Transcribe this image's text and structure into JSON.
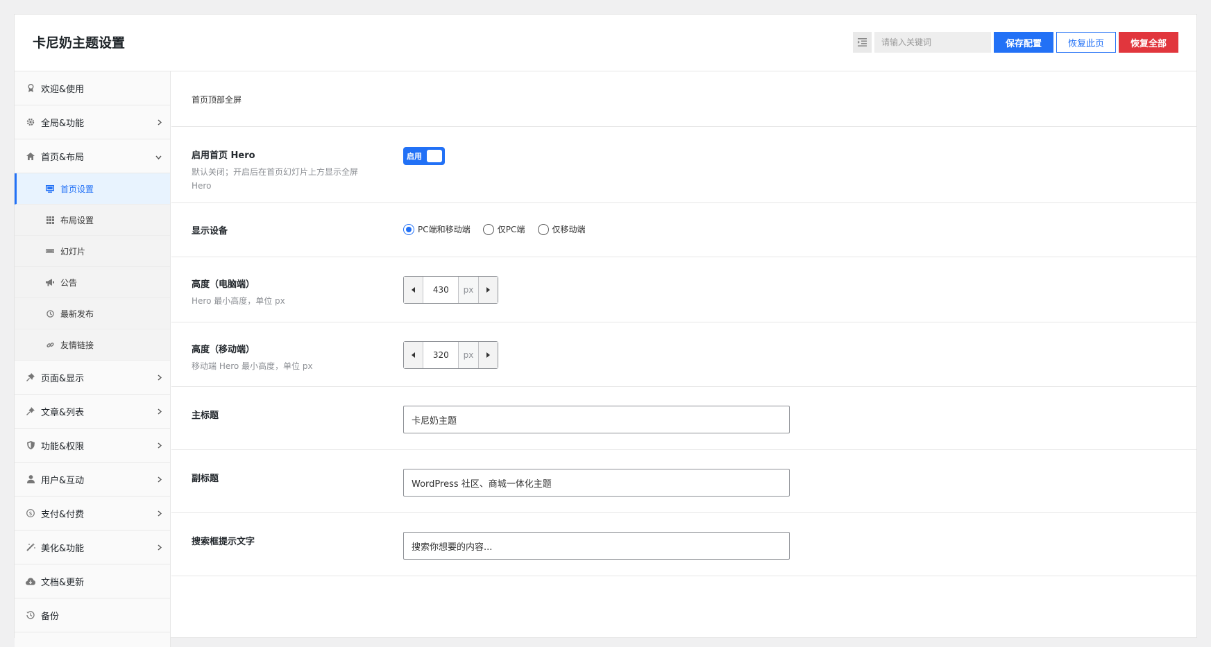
{
  "header": {
    "title": "卡尼奶主题设置",
    "search_placeholder": "请输入关键词",
    "save_label": "保存配置",
    "restore_page_label": "恢复此页",
    "restore_all_label": "恢复全部"
  },
  "sidebar": {
    "items": [
      {
        "label": "欢迎&使用",
        "icon": "award-icon",
        "has_chevron": false
      },
      {
        "label": "全局&功能",
        "icon": "gear-icon",
        "has_chevron": true,
        "chevron": "right"
      },
      {
        "label": "首页&布局",
        "icon": "home-icon",
        "has_chevron": true,
        "chevron": "down",
        "expanded": true
      },
      {
        "label": "页面&显示",
        "icon": "thumbtack-icon",
        "has_chevron": true,
        "chevron": "right"
      },
      {
        "label": "文章&列表",
        "icon": "pin-icon",
        "has_chevron": true,
        "chevron": "right"
      },
      {
        "label": "功能&权限",
        "icon": "shield-icon",
        "has_chevron": true,
        "chevron": "right"
      },
      {
        "label": "用户&互动",
        "icon": "user-icon",
        "has_chevron": true,
        "chevron": "right"
      },
      {
        "label": "支付&付费",
        "icon": "dollar-icon",
        "has_chevron": true,
        "chevron": "right"
      },
      {
        "label": "美化&功能",
        "icon": "magic-wand-icon",
        "has_chevron": true,
        "chevron": "right"
      },
      {
        "label": "文档&更新",
        "icon": "cloud-download-icon",
        "has_chevron": false
      },
      {
        "label": "备份",
        "icon": "history-icon",
        "has_chevron": false
      }
    ],
    "subitems": [
      {
        "label": "首页设置",
        "icon": "desktop-icon",
        "active": true
      },
      {
        "label": "布局设置",
        "icon": "grid-icon",
        "active": false
      },
      {
        "label": "幻灯片",
        "icon": "slider-icon",
        "active": false
      },
      {
        "label": "公告",
        "icon": "bullhorn-icon",
        "active": false
      },
      {
        "label": "最新发布",
        "icon": "clock-icon",
        "active": false
      },
      {
        "label": "友情链接",
        "icon": "link-icon",
        "active": false
      }
    ]
  },
  "main": {
    "section_title": "首页顶部全屏",
    "hero": {
      "title": "启用首页 Hero",
      "desc": "默认关闭；开启后在首页幻灯片上方显示全屏 Hero",
      "toggle_label": "启用",
      "enabled": true
    },
    "devices": {
      "title": "显示设备",
      "options": [
        "PC端和移动端",
        "仅PC端",
        "仅移动端"
      ],
      "selected": "PC端和移动端"
    },
    "height_pc": {
      "title": "高度（电脑端）",
      "desc": "Hero 最小高度，单位 px",
      "value": "430",
      "unit": "px"
    },
    "height_mobile": {
      "title": "高度（移动端）",
      "desc": "移动端 Hero 最小高度，单位 px",
      "value": "320",
      "unit": "px"
    },
    "main_title": {
      "title": "主标题",
      "value": "卡尼奶主题"
    },
    "sub_title": {
      "title": "副标题",
      "value": "WordPress 社区、商城一体化主题"
    },
    "search_hint": {
      "title": "搜索框提示文字",
      "value": "搜索你想要的内容..."
    }
  },
  "colors": {
    "accent": "#2271f6",
    "danger": "#e1363d"
  }
}
